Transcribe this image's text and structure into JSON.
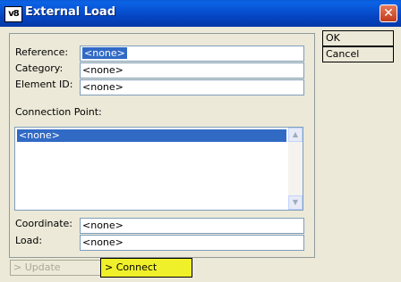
{
  "window": {
    "title": "External Load",
    "app_icon": "v8",
    "close_glyph": "✕"
  },
  "buttons": {
    "ok": "OK",
    "cancel": "Cancel",
    "update": "> Update",
    "connect": "> Connect"
  },
  "form": {
    "reference": {
      "label": "Reference:",
      "value": "<none>"
    },
    "category": {
      "label": "Category:",
      "value": "<none>"
    },
    "element_id": {
      "label": "Element ID:",
      "value": "<none>"
    },
    "connection_point": {
      "label": "Connection Point:",
      "items": [
        "<none>"
      ]
    },
    "coordinate": {
      "label": "Coordinate:",
      "value": "<none>"
    },
    "load": {
      "label": "Load:",
      "value": "<none>"
    }
  },
  "icons": {
    "scroll_up": "scroll-up-arrow",
    "scroll_down": "scroll-down-arrow"
  }
}
